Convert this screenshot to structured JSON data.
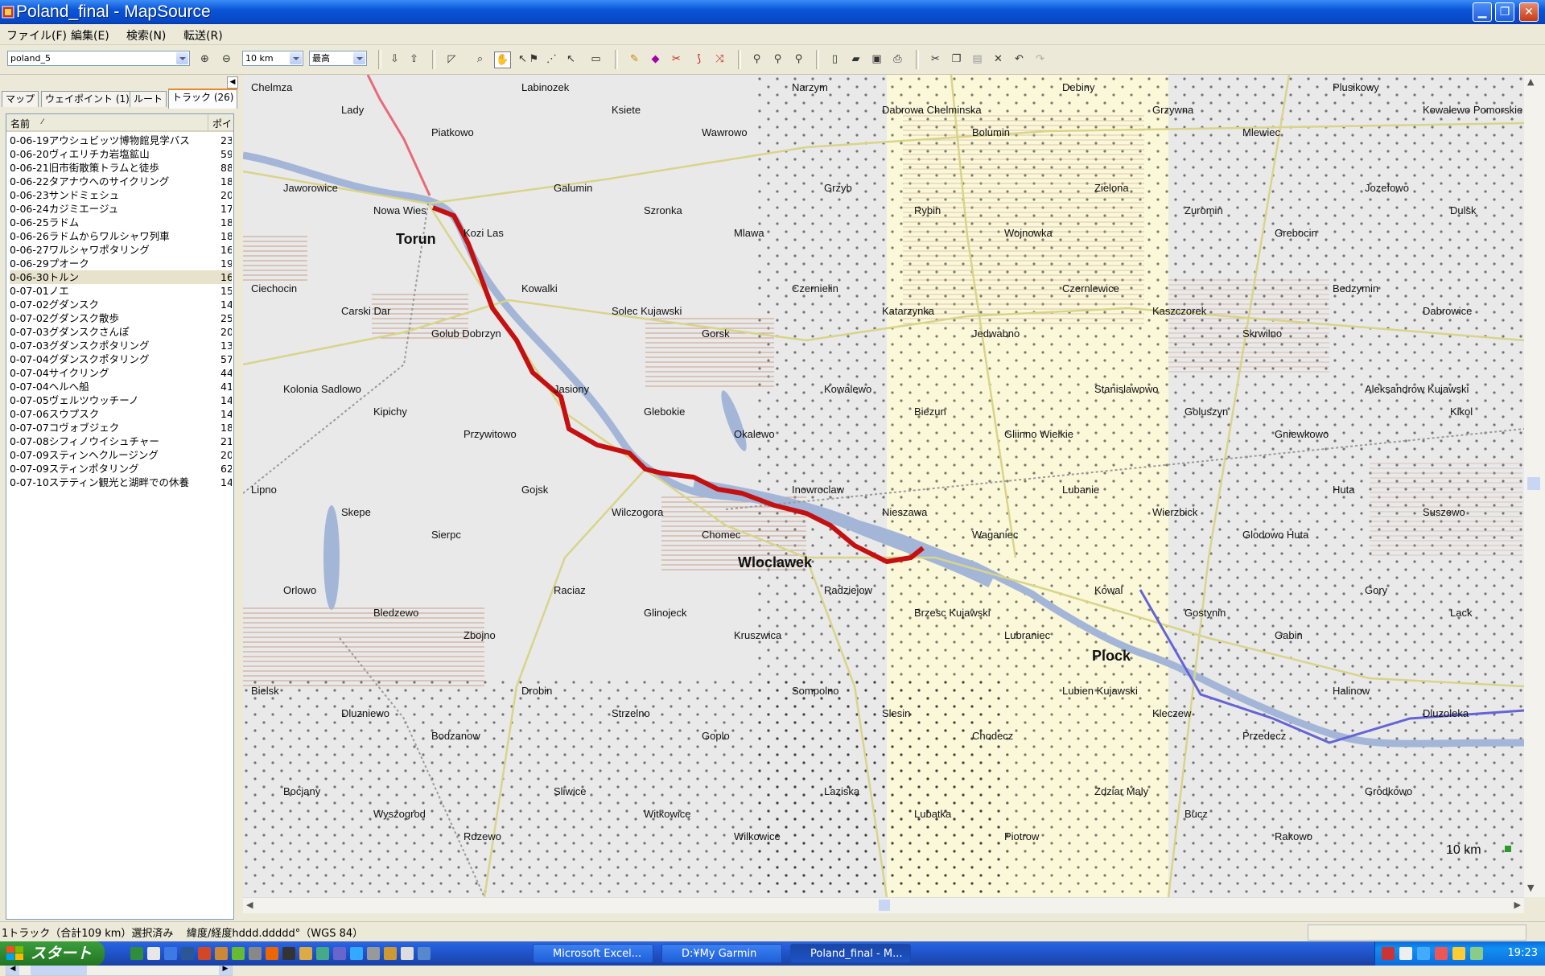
{
  "window": {
    "title": "Poland_final - MapSource"
  },
  "menu": [
    "ファイル(F)",
    "編集(E)",
    "検索(N)",
    "転送(R)"
  ],
  "toolbar": {
    "map_product": "poland_5",
    "zoom_level": "10 km",
    "detail_level": "最高"
  },
  "left_panel": {
    "tabs": [
      {
        "label": "マップ",
        "active": false
      },
      {
        "label": "ウェイポイント (1)",
        "active": false
      },
      {
        "label": "ルート",
        "active": false
      },
      {
        "label": "トラック (26)",
        "active": true
      }
    ],
    "columns": {
      "name": "名前",
      "points": "ポイ"
    },
    "tracks": [
      {
        "name": "0-06-19アウシュビッツ博物館見学バス",
        "points": "23"
      },
      {
        "name": "0-06-20ヴィエリチカ岩塩鉱山",
        "points": "59"
      },
      {
        "name": "0-06-21旧市街散策トラムと徒歩",
        "points": "88"
      },
      {
        "name": "0-06-22タアナウへのサイクリング",
        "points": "18"
      },
      {
        "name": "0-06-23サンドミェシュ",
        "points": "20"
      },
      {
        "name": "0-06-24カジミエージュ",
        "points": "17"
      },
      {
        "name": "0-06-25ラドム",
        "points": "18"
      },
      {
        "name": "0-06-26ラドムからワルシャワ列車",
        "points": "18"
      },
      {
        "name": "0-06-27ワルシャワポタリング",
        "points": "16"
      },
      {
        "name": "0-06-29プオーク",
        "points": "19"
      },
      {
        "name": "0-06-30トルン",
        "points": "16",
        "selected": true
      },
      {
        "name": "0-07-01ノエ",
        "points": "15"
      },
      {
        "name": "0-07-02グダンスク",
        "points": "14"
      },
      {
        "name": "0-07-02グダンスク散歩",
        "points": "25"
      },
      {
        "name": "0-07-03グダンスクさんぽ",
        "points": "20"
      },
      {
        "name": "0-07-03グダンスクポタリング",
        "points": "13"
      },
      {
        "name": "0-07-04グダンスクポタリング",
        "points": "57"
      },
      {
        "name": "0-07-04サイクリング",
        "points": "44"
      },
      {
        "name": "0-07-04ヘルへ船",
        "points": "41"
      },
      {
        "name": "0-07-05ヴェルツウッチーノ",
        "points": "14"
      },
      {
        "name": "0-07-06スウプスク",
        "points": "14"
      },
      {
        "name": "0-07-07コヴォブジェク",
        "points": "18"
      },
      {
        "name": "0-07-08シフィノウイシュチャー",
        "points": "21"
      },
      {
        "name": "0-07-09スティンヘクルージング",
        "points": "20"
      },
      {
        "name": "0-07-09スティンポタリング",
        "points": "62"
      },
      {
        "name": "0-07-10ステティン観光と湖畔での休養",
        "points": "14"
      }
    ]
  },
  "map": {
    "cities_major": [
      {
        "name": "Torun"
      },
      {
        "name": "Wloclawek"
      },
      {
        "name": "Plock"
      }
    ],
    "places": [
      "Chelmza",
      "Lady",
      "Piatkowo",
      "Labinozek",
      "Ksiete",
      "Wawrowo",
      "Narzym",
      "Dabrowa Chelminska",
      "Bolumin",
      "Debiny",
      "Grzywna",
      "Mlewiec",
      "Plusikowy",
      "Kowalewo Pomorskie",
      "Jaworowice",
      "Nowa Wies",
      "Kozi Las",
      "Galumin",
      "Szronka",
      "Mlawa",
      "Grzyb",
      "Rybin",
      "Wojnowka",
      "Zielona",
      "Zuromin",
      "Grebocin",
      "Jozefowo",
      "Dulsk",
      "Ciechocin",
      "Carski Dar",
      "Golub Dobrzyn",
      "Kowalki",
      "Solec Kujawski",
      "Gorsk",
      "Czernielin",
      "Katarzynka",
      "Jedwabno",
      "Czernlewice",
      "Kaszczorek",
      "Skrwilno",
      "Bedzymin",
      "Dabrowice",
      "Kolonia Sadlowo",
      "Kipichy",
      "Przywitowo",
      "Jasiony",
      "Glebokie",
      "Okalewo",
      "Kowalewo",
      "Biezun",
      "Gliinno Wielkie",
      "Stanislawowo",
      "Goluszyn",
      "Gniewkowo",
      "Aleksandrow Kujawski",
      "Kikol",
      "Lipno",
      "Skepe",
      "Sierpc",
      "Gojsk",
      "Wilczogora",
      "Chomec",
      "Inowroclaw",
      "Nieszawa",
      "Waganiec",
      "Lubanie",
      "Wierzbick",
      "Glodowo Huta",
      "Huta",
      "Suszewo",
      "Orlowo",
      "Bledzewo",
      "Zbojno",
      "Raciaz",
      "Glinojeck",
      "Kruszwica",
      "Radziejow",
      "Brzesc Kujawski",
      "Lubraniec",
      "Kowal",
      "Gostynin",
      "Gabin",
      "Gory",
      "Lack",
      "Bielsk",
      "Dluzniewo",
      "Bodzanow",
      "Drobin",
      "Strzelno",
      "Goplo",
      "Sompolno",
      "Slesin",
      "Chodecz",
      "Lubien Kujawski",
      "Kleczew",
      "Przedecz",
      "Halinow",
      "Dluzoleka",
      "Bocjany",
      "Wyszogrod",
      "Rdzewo",
      "Sliwice",
      "Witkowice",
      "Wilkowice",
      "Laziska",
      "Lubatka",
      "Piotrow",
      "Zdziar Maly",
      "Bucz",
      "Rakowo",
      "Grodkowo"
    ],
    "scale_label": "10 km"
  },
  "statusbar": {
    "selection": "1トラック（合計109 km）選択済み",
    "coord_format": "緯度/経度hddd.ddddd°（WGS 84）"
  },
  "taskbar": {
    "start_label": "スタート",
    "tasks": [
      "Microsoft Excel...",
      "D:¥My Garmin",
      "Poland_final - M..."
    ],
    "clock": "19:23"
  },
  "colors": {
    "track": "#c41010",
    "route_blue": "#6464d6",
    "track_pink": "#e86a7a",
    "water": "#a3b6d8",
    "road_yellow": "#d8d48a",
    "map_bg": "#e9e9e9",
    "title_blue": "#0a56d8"
  }
}
